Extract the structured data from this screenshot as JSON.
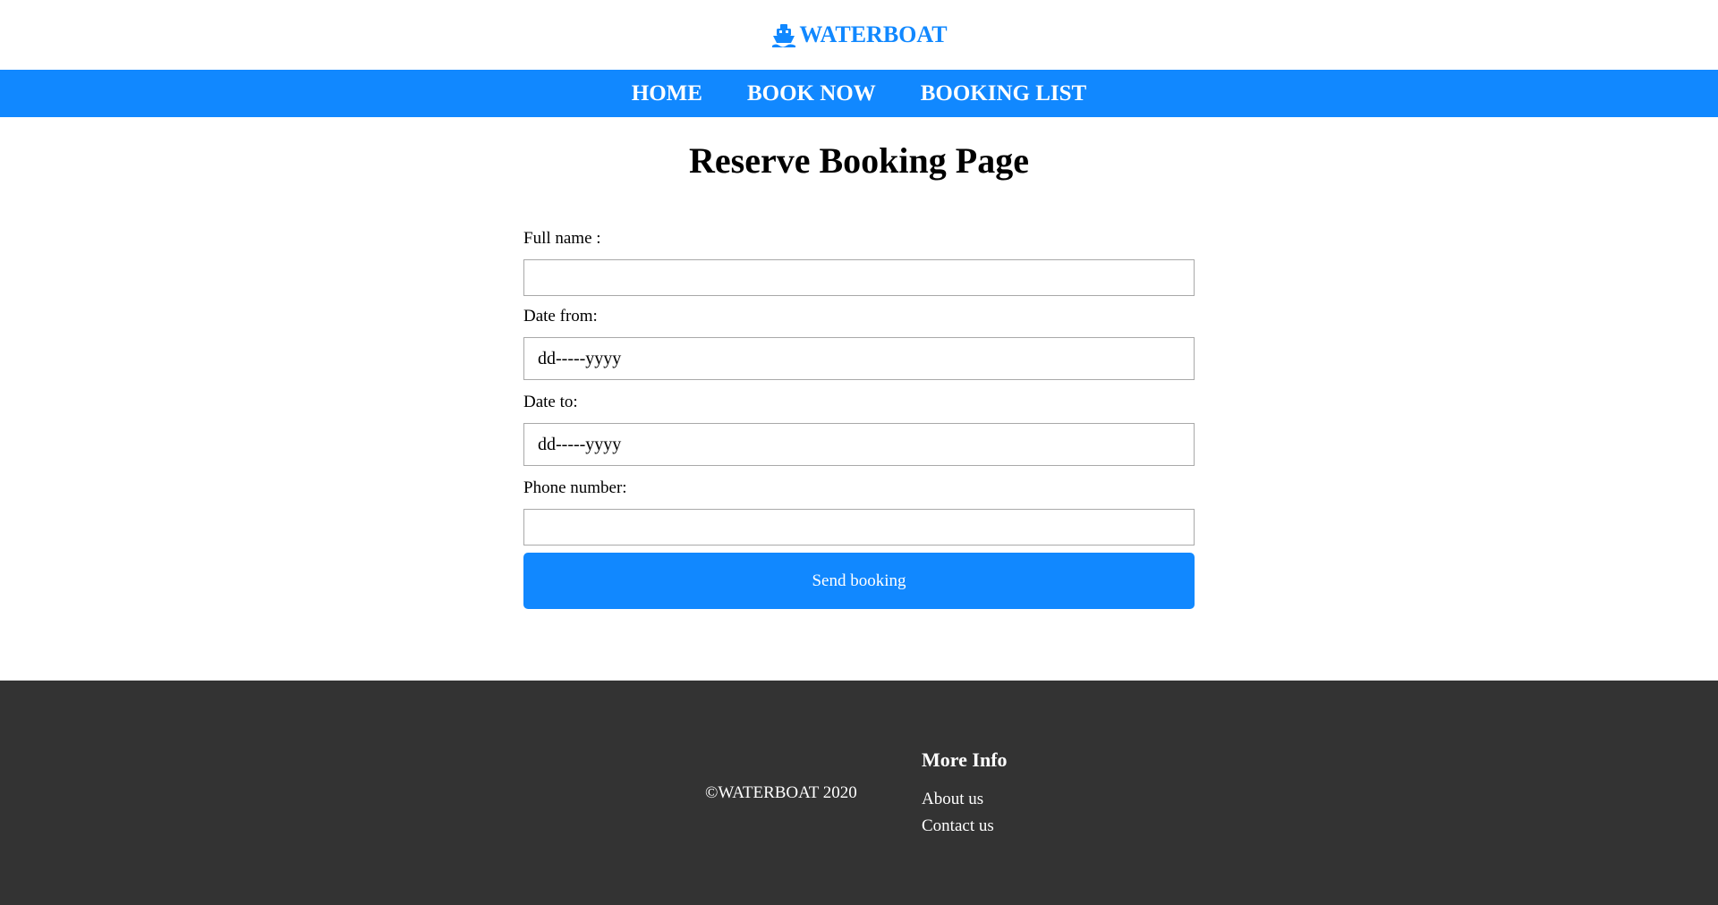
{
  "header": {
    "brand": "WATERBOAT",
    "brand_color": "#1188ff",
    "brand_icon": "ship-icon"
  },
  "nav": {
    "items": [
      {
        "label": "HOME"
      },
      {
        "label": "BOOK NOW"
      },
      {
        "label": "BOOKING LIST"
      }
    ],
    "background_color": "#1188ff"
  },
  "main": {
    "title": "Reserve Booking Page",
    "form": {
      "full_name_label": "Full name :",
      "full_name_value": "",
      "date_from_label": "Date from:",
      "date_from_value": "dd-----yyyy",
      "date_to_label": "Date to:",
      "date_to_value": "dd-----yyyy",
      "phone_label": "Phone number:",
      "phone_value": "",
      "submit_label": "Send booking"
    }
  },
  "footer": {
    "copyright": "©WATERBOAT 2020",
    "more_info_title": "More Info",
    "links": [
      {
        "label": "About us"
      },
      {
        "label": "Contact us"
      }
    ],
    "background_color": "#333333"
  }
}
